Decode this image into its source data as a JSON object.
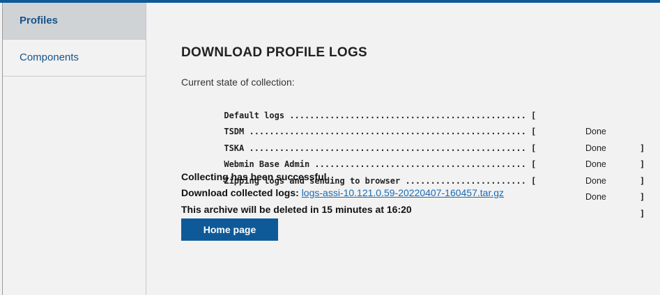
{
  "sidebar": {
    "items": [
      {
        "label": "Profiles",
        "active": true
      },
      {
        "label": "Components",
        "active": false
      }
    ]
  },
  "main": {
    "title": "DOWNLOAD PROFILE LOGS",
    "state_label": "Current state of collection:",
    "log_lines": [
      {
        "text": "Default logs ............................................... [",
        "status": "Done",
        "close": "]"
      },
      {
        "text": "TSDM ....................................................... [",
        "status": "Done",
        "close": "]"
      },
      {
        "text": "TSKA ....................................................... [",
        "status": "Done",
        "close": "]"
      },
      {
        "text": "Webmin Base Admin .......................................... [",
        "status": "Done",
        "close": "]"
      },
      {
        "text": "Zipping logs and sending to browser ........................ [",
        "status": "Done",
        "close": "]"
      }
    ],
    "success_message": "Collecting has been successful",
    "download_label": "Download collected logs:",
    "download_link": "logs-assi-10.121.0.59-20220407-160457.tar.gz",
    "delete_notice": "This archive will be deleted in 15 minutes at 16:20",
    "home_button": "Home page"
  },
  "colors": {
    "accent": "#0e5a99",
    "link": "#1a6bb5",
    "background": "#f2f2f2",
    "active_nav": "#cfd3d6"
  }
}
